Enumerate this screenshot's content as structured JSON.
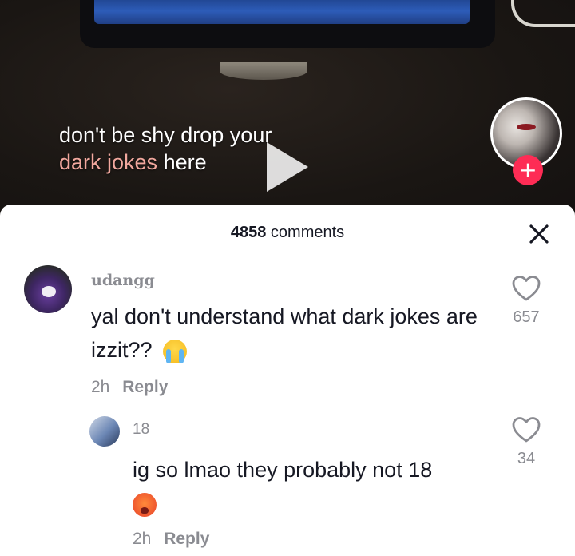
{
  "video": {
    "caption_line1": "don't be shy drop your",
    "caption_highlight": "dark jokes",
    "caption_end": "here",
    "follow_symbol": "+"
  },
  "comments_panel": {
    "count": "4858",
    "count_label": "comments",
    "close_symbol": "×"
  },
  "comments": [
    {
      "username": "udangg",
      "text": "yal don't understand what dark jokes are izzit??",
      "emoji": "loudly-crying-face",
      "time": "2h",
      "reply_label": "Reply",
      "likes": "657"
    },
    {
      "username": "18",
      "text": "ig so lmao they probably not 18",
      "emoji": "hot-face",
      "time": "2h",
      "reply_label": "Reply",
      "likes": "34"
    }
  ],
  "colors": {
    "accent": "#fe2c55",
    "caption_highlight": "#f2a89e",
    "secondary_text": "#8a8b91",
    "primary_text": "#161823"
  }
}
